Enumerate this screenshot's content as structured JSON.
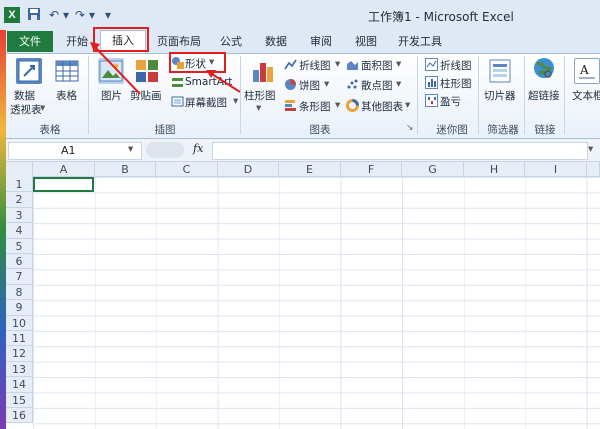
{
  "window": {
    "title": "工作簿1 - Microsoft Excel",
    "app_icon": "X"
  },
  "quick_access": [
    "save-icon",
    "undo-icon",
    "redo-icon",
    "customize-icon"
  ],
  "tabs": {
    "file": "文件",
    "items": [
      "开始",
      "插入",
      "页面布局",
      "公式",
      "数据",
      "审阅",
      "视图",
      "开发工具"
    ],
    "active": "插入"
  },
  "ribbon": {
    "tables": {
      "label": "表格",
      "pivot_line1": "数据",
      "pivot_line2": "透视表",
      "table": "表格"
    },
    "illustrations": {
      "label": "插图",
      "picture": "图片",
      "clipart": "剪贴画",
      "shapes": "形状",
      "smartart": "SmartArt",
      "screenshot": "屏幕截图"
    },
    "charts": {
      "label": "图表",
      "column": "柱形图",
      "line": "折线图",
      "pie": "饼图",
      "bar": "条形图",
      "area": "面积图",
      "scatter": "散点图",
      "other": "其他图表"
    },
    "sparklines": {
      "label": "迷你图",
      "line": "折线图",
      "column": "柱形图",
      "winloss": "盈亏"
    },
    "filter": {
      "label": "筛选器",
      "slicer": "切片器"
    },
    "links": {
      "label": "链接",
      "hyperlink": "超链接"
    },
    "text": {
      "textbox": "文本框"
    }
  },
  "formula_bar": {
    "name_box": "A1",
    "fx": "fx",
    "value": ""
  },
  "grid": {
    "columns": [
      "A",
      "B",
      "C",
      "D",
      "E",
      "F",
      "G",
      "H",
      "I"
    ],
    "rows": [
      "1",
      "2",
      "3",
      "4",
      "5",
      "6",
      "7",
      "8",
      "9",
      "10",
      "11",
      "12",
      "13",
      "14",
      "15",
      "16"
    ]
  },
  "colors": {
    "file_tab": "#1f7c3e",
    "annotation": "#e02020"
  }
}
